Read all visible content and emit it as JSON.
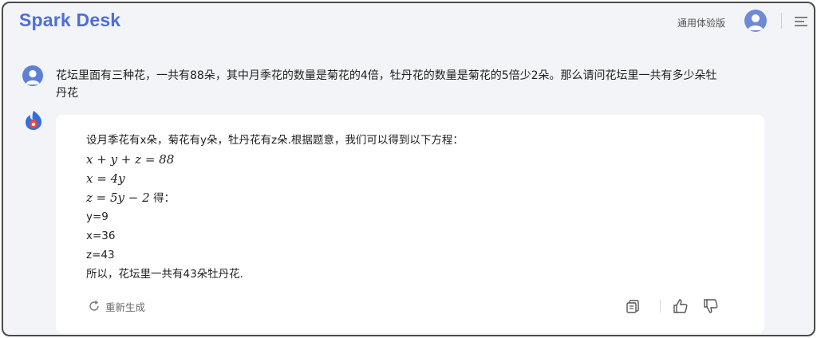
{
  "app": {
    "logo": "Spark Desk",
    "trial_label": "通用体验版"
  },
  "conversation": {
    "user_message": "花坛里面有三种花，一共有88朵，其中月季花的数量是菊花的4倍，牡丹花的数量是菊花的5倍少2朵。那么请问花坛里一共有多少朵牡丹花",
    "bot_response": {
      "intro": "设月季花有x朵，菊花有y朵，牡丹花有z朵.根据题意，我们可以得到以下方程：",
      "eq1": "x + y + z = 88",
      "eq2": "x = 4y",
      "eq3": "z = 5y − 2",
      "eq3_suffix": " 得：",
      "y_value": "y=9",
      "x_value": "x=36",
      "z_value": "z=43",
      "conclusion": "所以，花坛里一共有43朵牡丹花."
    },
    "actions": {
      "regenerate_label": "重新生成"
    }
  },
  "icons": {
    "menu": "menu-icon",
    "user": "user-icon",
    "bot": "spark-logo-icon",
    "regenerate": "refresh-icon",
    "copy": "copy-icon",
    "like": "thumbs-up-icon",
    "dislike": "thumbs-down-icon"
  },
  "colors": {
    "brand": "#4f6ddb",
    "avatar": "#6e8ad6",
    "background": "#f3f4f8",
    "card": "#ffffff"
  }
}
